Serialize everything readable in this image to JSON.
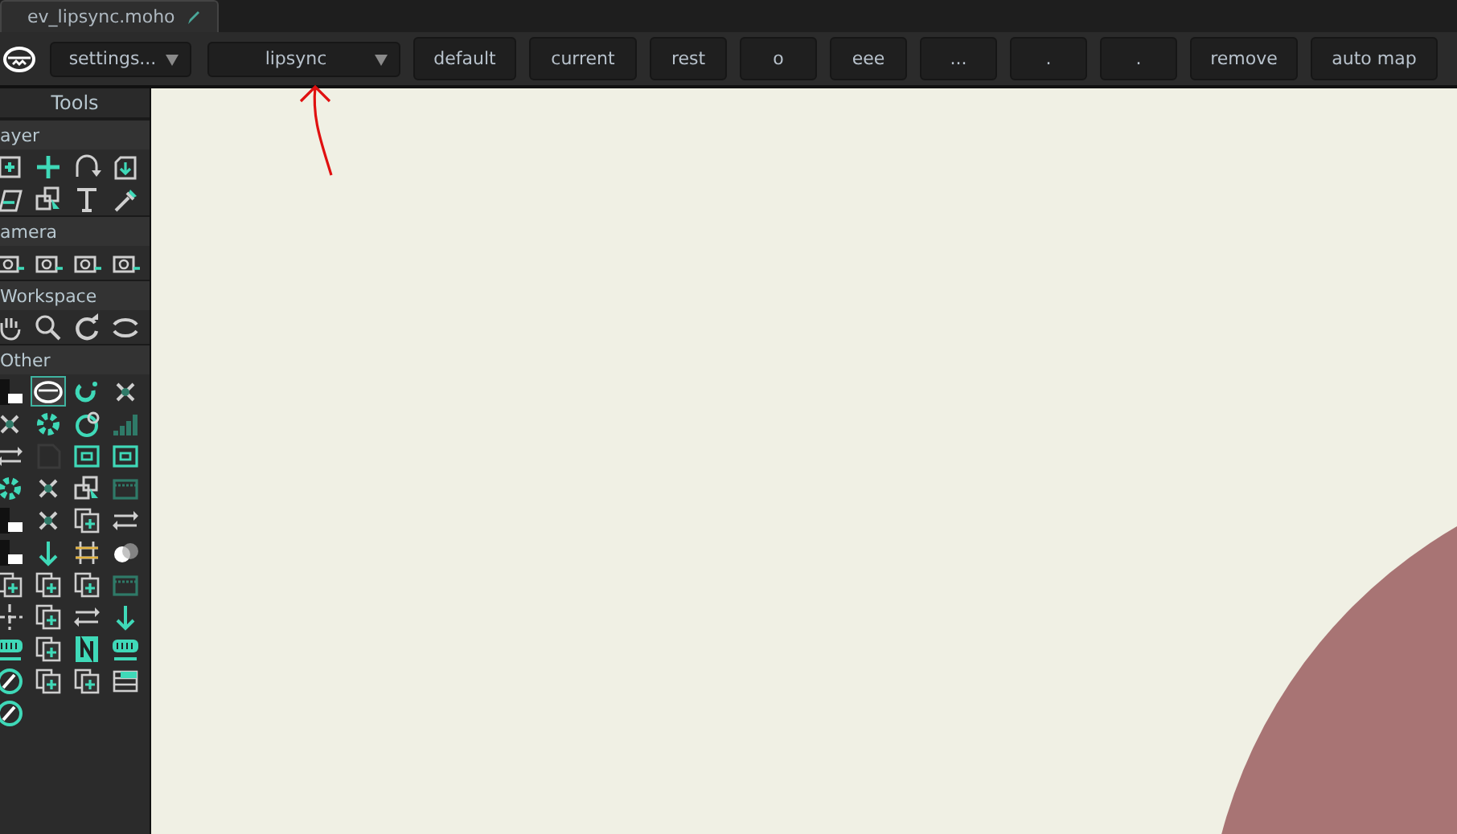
{
  "document_tab": {
    "title": "ev_lipsync.moho"
  },
  "toolbar": {
    "dropdowns": [
      {
        "label": "settings..."
      },
      {
        "label": "lipsync"
      }
    ],
    "buttons": [
      "default",
      "current",
      "rest",
      "o",
      "eee",
      "...",
      ".",
      ".",
      "remove",
      "auto map"
    ]
  },
  "tools": {
    "title": "Tools",
    "sections": [
      {
        "label": "ayer",
        "tools": [
          {
            "selected": false
          },
          {
            "selected": false
          },
          {
            "selected": false
          },
          {
            "selected": false
          },
          {
            "selected": false
          },
          {
            "selected": false
          },
          {
            "selected": false
          },
          {
            "selected": false
          }
        ]
      },
      {
        "label": "amera",
        "tools": [
          {
            "selected": false
          },
          {
            "selected": false
          },
          {
            "selected": false
          },
          {
            "selected": false
          }
        ]
      },
      {
        "label": "Workspace",
        "tools": [
          {
            "selected": false
          },
          {
            "selected": false
          },
          {
            "selected": false
          },
          {
            "selected": false
          }
        ]
      },
      {
        "label": "Other",
        "tools": [
          {
            "selected": false
          },
          {
            "selected": true
          },
          {
            "selected": false
          },
          {
            "selected": false
          },
          {
            "selected": false
          },
          {
            "selected": false
          },
          {
            "selected": false
          },
          {
            "selected": false
          },
          {
            "selected": false
          },
          {
            "selected": false
          },
          {
            "selected": false
          },
          {
            "selected": false
          },
          {
            "selected": false
          },
          {
            "selected": false
          },
          {
            "selected": false
          },
          {
            "selected": false
          },
          {
            "selected": false
          },
          {
            "selected": false
          },
          {
            "selected": false
          },
          {
            "selected": false
          },
          {
            "selected": false
          },
          {
            "selected": false
          },
          {
            "selected": false
          },
          {
            "selected": false
          },
          {
            "selected": false
          },
          {
            "selected": false
          },
          {
            "selected": false
          },
          {
            "selected": false
          },
          {
            "selected": false
          },
          {
            "selected": false
          },
          {
            "selected": false
          },
          {
            "selected": false
          },
          {
            "selected": false
          },
          {
            "selected": false
          },
          {
            "selected": false
          },
          {
            "selected": false
          },
          {
            "selected": false
          },
          {
            "selected": false
          },
          {
            "selected": false
          },
          {
            "selected": false
          },
          {
            "selected": false
          }
        ]
      }
    ]
  }
}
